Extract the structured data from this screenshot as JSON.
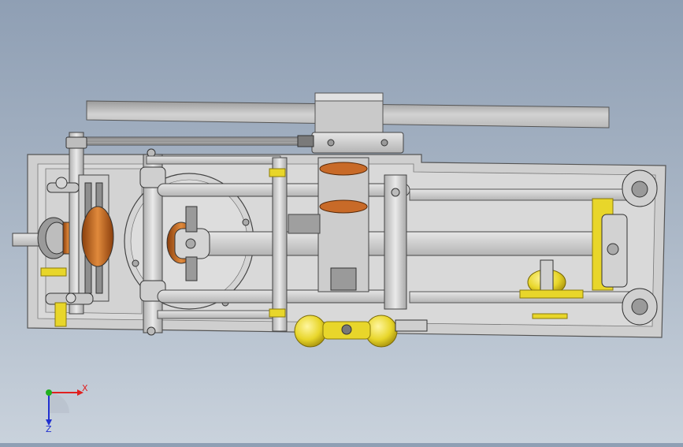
{
  "viewport": {
    "background_top": "#8f9fb4",
    "background_bottom": "#c9d2dc",
    "model_colors": {
      "steel": "#c6c6c6",
      "steel_light": "#dcdcdc",
      "steel_dark": "#8c8c8c",
      "outline": "#4a4a4a",
      "bronze": "#c0651f",
      "brass": "#e8d62a",
      "brass_dark": "#b9a214"
    }
  },
  "triad": {
    "x_label": "X",
    "y_label": "Y",
    "z_label": "Z",
    "x_color": "#e02020",
    "y_color": "#20b020",
    "z_color": "#2030d0"
  }
}
